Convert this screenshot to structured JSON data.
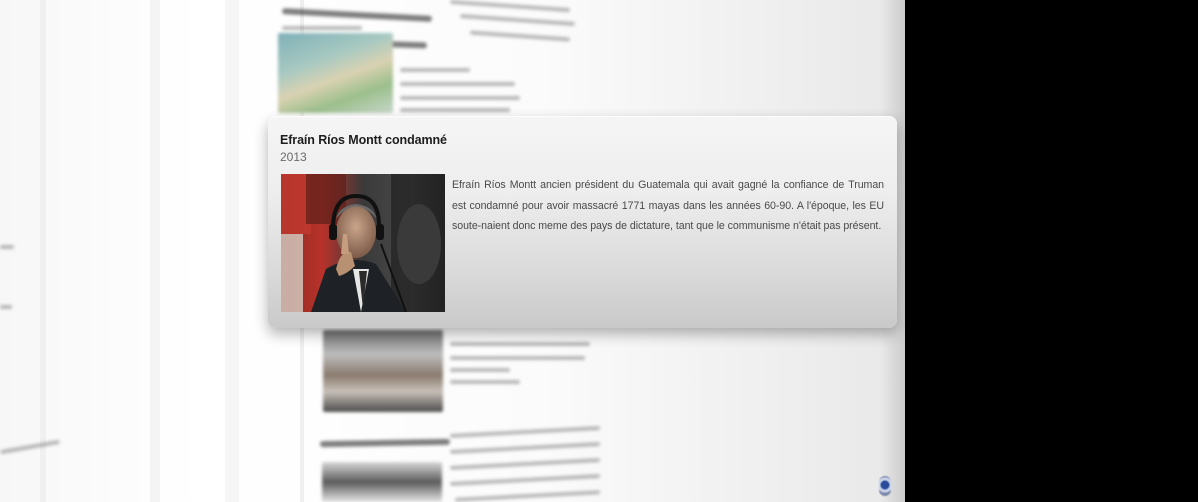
{
  "event": {
    "title": "Efraín Ríos Montt condamné",
    "year": "2013",
    "description": "Efraín Ríos Montt ancien président du Guatemala qui avait gagné la confiance de Truman est condamné pour avoir massacré 1771 mayas dans les années 60-90. A l'époque, les EU soute-naient donc meme des pays de dictature, tant que le communisme n'était pas présent.",
    "photo_icon": "portrait-photo"
  },
  "colors": {
    "card_top": "#f5f5f5",
    "card_bottom": "#c9c9c9",
    "title_text": "#1d1d1d",
    "year_text": "#6a6a6a",
    "body_text": "#4a4a4a",
    "outer_background": "#000000"
  }
}
